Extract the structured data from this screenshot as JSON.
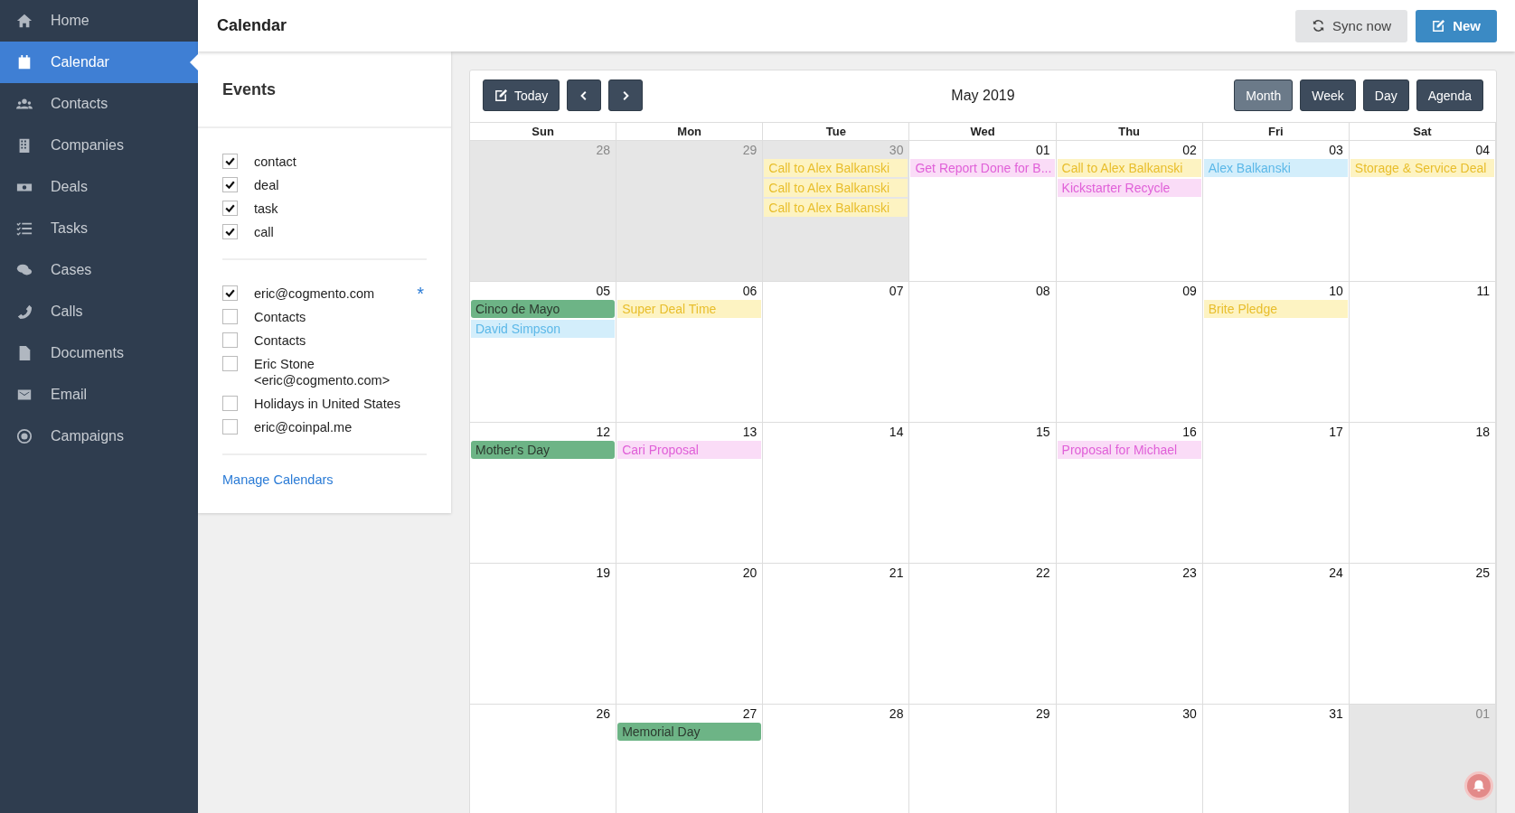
{
  "sidebar": {
    "items": [
      {
        "label": "Home",
        "selected": false
      },
      {
        "label": "Calendar",
        "selected": true
      },
      {
        "label": "Contacts",
        "selected": false
      },
      {
        "label": "Companies",
        "selected": false
      },
      {
        "label": "Deals",
        "selected": false
      },
      {
        "label": "Tasks",
        "selected": false
      },
      {
        "label": "Cases",
        "selected": false
      },
      {
        "label": "Calls",
        "selected": false
      },
      {
        "label": "Documents",
        "selected": false
      },
      {
        "label": "Email",
        "selected": false
      },
      {
        "label": "Campaigns",
        "selected": false
      }
    ]
  },
  "header": {
    "title": "Calendar",
    "buttons": [
      {
        "label": "Sync now",
        "kind": "sync"
      },
      {
        "label": "New",
        "kind": "new"
      }
    ]
  },
  "events_panel": {
    "title": "Events",
    "types": [
      {
        "label": "contact",
        "checked": true
      },
      {
        "label": "deal",
        "checked": true
      },
      {
        "label": "task",
        "checked": true
      },
      {
        "label": "call",
        "checked": true
      }
    ],
    "calendars": [
      {
        "label": "eric@cogmento.com",
        "checked": true,
        "marker": "*"
      },
      {
        "label": "Contacts",
        "checked": false
      },
      {
        "label": "Contacts",
        "checked": false
      },
      {
        "label": "Eric Stone <eric@cogmento.com>",
        "checked": false
      },
      {
        "label": "Holidays in United States",
        "checked": false
      },
      {
        "label": "eric@coinpal.me",
        "checked": false
      }
    ],
    "link": "Manage Calendars"
  },
  "calendar": {
    "today_button": "Today",
    "title": "May 2019",
    "views": [
      {
        "label": "Month",
        "selected": true
      },
      {
        "label": "Week",
        "selected": false
      },
      {
        "label": "Day",
        "selected": false
      },
      {
        "label": "Agenda",
        "selected": false
      }
    ],
    "weekdays": [
      "Sun",
      "Mon",
      "Tue",
      "Wed",
      "Thu",
      "Fri",
      "Sat"
    ],
    "weeks": [
      {
        "days": [
          {
            "day": "28",
            "outside": true
          },
          {
            "day": "29",
            "outside": true
          },
          {
            "day": "30",
            "outside": true,
            "events": [
              {
                "title": "Call to Alex Balkanski",
                "kind": "call"
              },
              {
                "title": "Call to Alex Balkanski",
                "kind": "call"
              },
              {
                "title": "Call to Alex Balkanski",
                "kind": "call"
              }
            ]
          },
          {
            "day": "01",
            "outside": false,
            "events": [
              {
                "title": "Get Report Done for B...",
                "kind": "task"
              }
            ]
          },
          {
            "day": "02",
            "outside": false,
            "events": [
              {
                "title": "Call to Alex Balkanski",
                "kind": "call"
              },
              {
                "title": "Kickstarter Recycle",
                "kind": "task"
              }
            ]
          },
          {
            "day": "03",
            "outside": false,
            "events": [
              {
                "title": "Alex Balkanski",
                "kind": "contact"
              }
            ]
          },
          {
            "day": "04",
            "outside": false,
            "events": [
              {
                "title": "Storage & Service Deal",
                "kind": "call"
              }
            ]
          }
        ]
      },
      {
        "days": [
          {
            "day": "05",
            "outside": false,
            "events": [
              {
                "title": "Cinco de Mayo",
                "kind": "holiday"
              },
              {
                "title": "David Simpson",
                "kind": "contact"
              }
            ]
          },
          {
            "day": "06",
            "outside": false,
            "events": [
              {
                "title": "Super Deal Time",
                "kind": "call"
              }
            ]
          },
          {
            "day": "07",
            "outside": false
          },
          {
            "day": "08",
            "outside": false
          },
          {
            "day": "09",
            "outside": false
          },
          {
            "day": "10",
            "outside": false,
            "events": [
              {
                "title": "Brite Pledge",
                "kind": "call"
              }
            ]
          },
          {
            "day": "11",
            "outside": false
          }
        ]
      },
      {
        "days": [
          {
            "day": "12",
            "outside": false,
            "events": [
              {
                "title": "Mother's Day",
                "kind": "holiday"
              }
            ]
          },
          {
            "day": "13",
            "outside": false,
            "events": [
              {
                "title": "Cari Proposal",
                "kind": "task"
              }
            ]
          },
          {
            "day": "14",
            "outside": false
          },
          {
            "day": "15",
            "outside": false
          },
          {
            "day": "16",
            "outside": false,
            "events": [
              {
                "title": "Proposal for Michael",
                "kind": "task"
              }
            ]
          },
          {
            "day": "17",
            "outside": false
          },
          {
            "day": "18",
            "outside": false
          }
        ]
      },
      {
        "days": [
          {
            "day": "19",
            "outside": false
          },
          {
            "day": "20",
            "outside": false
          },
          {
            "day": "21",
            "outside": false
          },
          {
            "day": "22",
            "outside": false
          },
          {
            "day": "23",
            "outside": false
          },
          {
            "day": "24",
            "outside": false
          },
          {
            "day": "25",
            "outside": false
          }
        ]
      },
      {
        "days": [
          {
            "day": "26",
            "outside": false
          },
          {
            "day": "27",
            "outside": false,
            "events": [
              {
                "title": "Memorial Day",
                "kind": "holiday"
              }
            ]
          },
          {
            "day": "28",
            "outside": false
          },
          {
            "day": "29",
            "outside": false
          },
          {
            "day": "30",
            "outside": false
          },
          {
            "day": "31",
            "outside": false
          },
          {
            "day": "01",
            "outside": true
          }
        ]
      }
    ]
  }
}
